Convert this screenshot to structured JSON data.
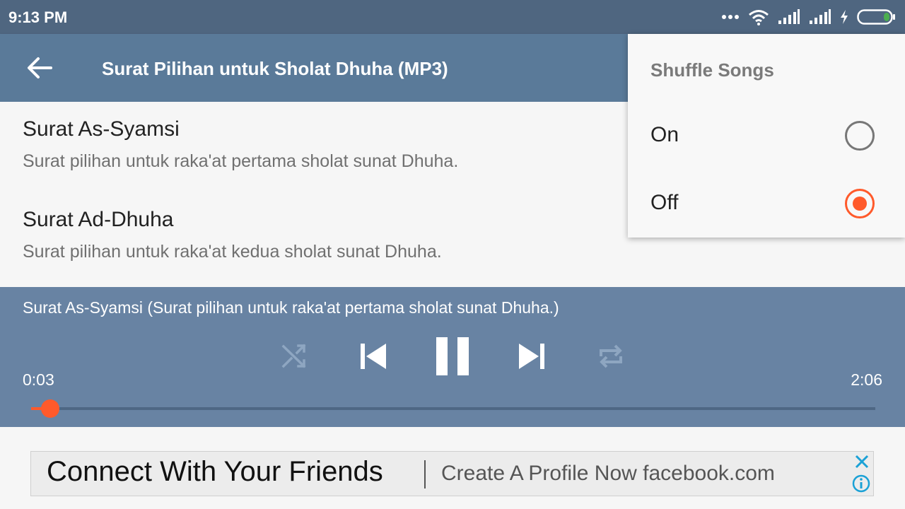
{
  "status_bar": {
    "time": "9:13 PM",
    "icons": [
      "more-dots-icon",
      "wifi-icon",
      "signal-icon",
      "signal-icon",
      "charging-icon",
      "battery-icon"
    ],
    "battery_color": "#4caf50"
  },
  "app_bar": {
    "title": "Surat Pilihan untuk Sholat Dhuha (MP3)",
    "back_icon": "arrow-left-icon",
    "color": "#5a7a99"
  },
  "tracks": [
    {
      "title": "Surat As-Syamsi",
      "subtitle": "Surat pilihan untuk raka'at pertama sholat sunat Dhuha."
    },
    {
      "title": "Surat Ad-Dhuha",
      "subtitle": "Surat pilihan untuk raka'at kedua sholat sunat Dhuha."
    }
  ],
  "player": {
    "now_playing": "Surat As-Syamsi (Surat pilihan untuk raka'at pertama sholat sunat Dhuha.)",
    "current_time": "0:03",
    "total_time": "2:06",
    "progress_fraction": 0.023,
    "controls": [
      "shuffle-icon",
      "skip-previous-icon",
      "pause-icon",
      "skip-next-icon",
      "repeat-icon"
    ],
    "accent": "#ff5a2b",
    "color": "#6883a3"
  },
  "ad": {
    "headline": "Connect With Your Friends",
    "subline": "Create A Profile Now facebook.com",
    "icons": [
      "close-icon",
      "info-icon"
    ],
    "accent": "#1aa1d6"
  },
  "shuffle_menu": {
    "title": "Shuffle Songs",
    "options": [
      {
        "label": "On",
        "selected": false
      },
      {
        "label": "Off",
        "selected": true
      }
    ]
  }
}
